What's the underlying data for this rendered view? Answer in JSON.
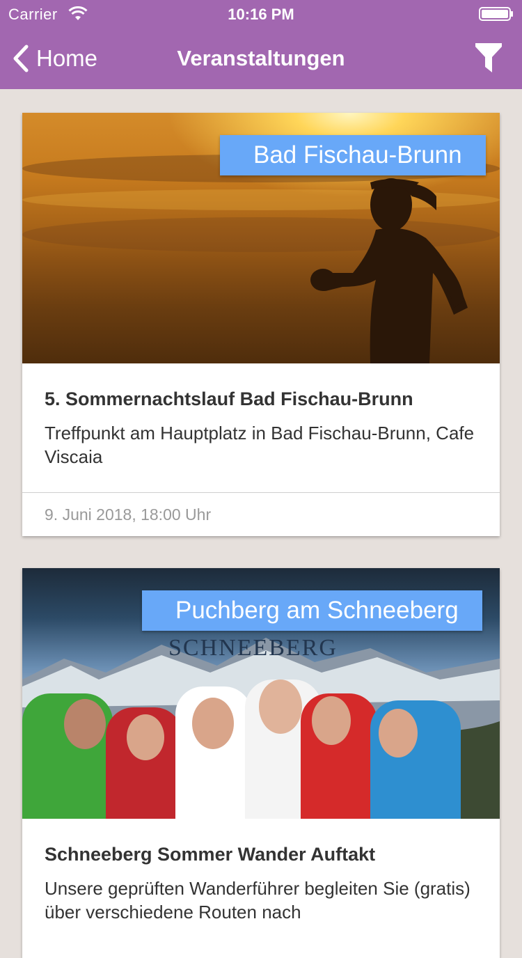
{
  "status_bar": {
    "carrier": "Carrier",
    "time": "10:16 PM"
  },
  "nav": {
    "back_label": "Home",
    "title": "Veranstaltungen"
  },
  "events": [
    {
      "location": "Bad Fischau-Brunn",
      "title": "5. Sommernachtslauf Bad Fischau-Brunn",
      "description": "Treffpunkt am Hauptplatz in Bad Fischau-Brunn, Cafe Viscaia",
      "date": "9. Juni 2018, 18:00 Uhr"
    },
    {
      "location": "Puchberg am Schneeberg",
      "title": "Schneeberg Sommer Wander Auftakt",
      "description": "Unsere geprüften Wanderführer begleiten Sie (gratis) über verschiedene Routen nach",
      "banner_text": "SCHNEEBERG"
    }
  ],
  "colors": {
    "nav_bar": "#a267b0",
    "badge": "#68a8f8",
    "background": "#e6e0dc"
  }
}
